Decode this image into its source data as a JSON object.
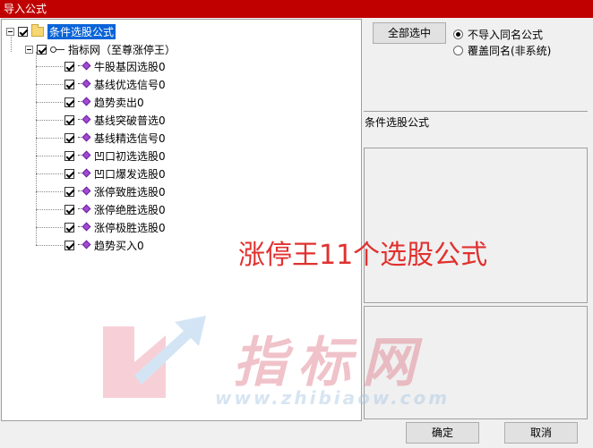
{
  "window": {
    "title": "导入公式"
  },
  "tree": {
    "root": {
      "label": "条件选股公式"
    },
    "group": {
      "label": "指标网（至尊涨停王）"
    },
    "items": [
      {
        "label": "牛股基因选股0"
      },
      {
        "label": "基线优选信号0"
      },
      {
        "label": "趋势卖出0"
      },
      {
        "label": "基线突破普选0"
      },
      {
        "label": "基线精选信号0"
      },
      {
        "label": "凹口初选选股0"
      },
      {
        "label": "凹口爆发选股0"
      },
      {
        "label": "涨停致胜选股0"
      },
      {
        "label": "涨停绝胜选股0"
      },
      {
        "label": "涨停极胜选股0"
      },
      {
        "label": "趋势买入0"
      }
    ]
  },
  "controls": {
    "select_all_label": "全部选中",
    "radio_options": [
      {
        "label": "不导入同名公式",
        "checked": true
      },
      {
        "label": "覆盖同名(非系统)",
        "checked": false
      }
    ]
  },
  "info": {
    "category_label": "条件选股公式"
  },
  "overlay": {
    "text": "涨停王11个选股公式"
  },
  "watermark": {
    "text": "指标网",
    "url": "www.zhibiaow.com"
  },
  "footer": {
    "ok_label": "确定",
    "cancel_label": "取消"
  },
  "colors": {
    "titlebar": "#c00000",
    "selection": "#0a64d8",
    "overlay": "#e0312f"
  }
}
